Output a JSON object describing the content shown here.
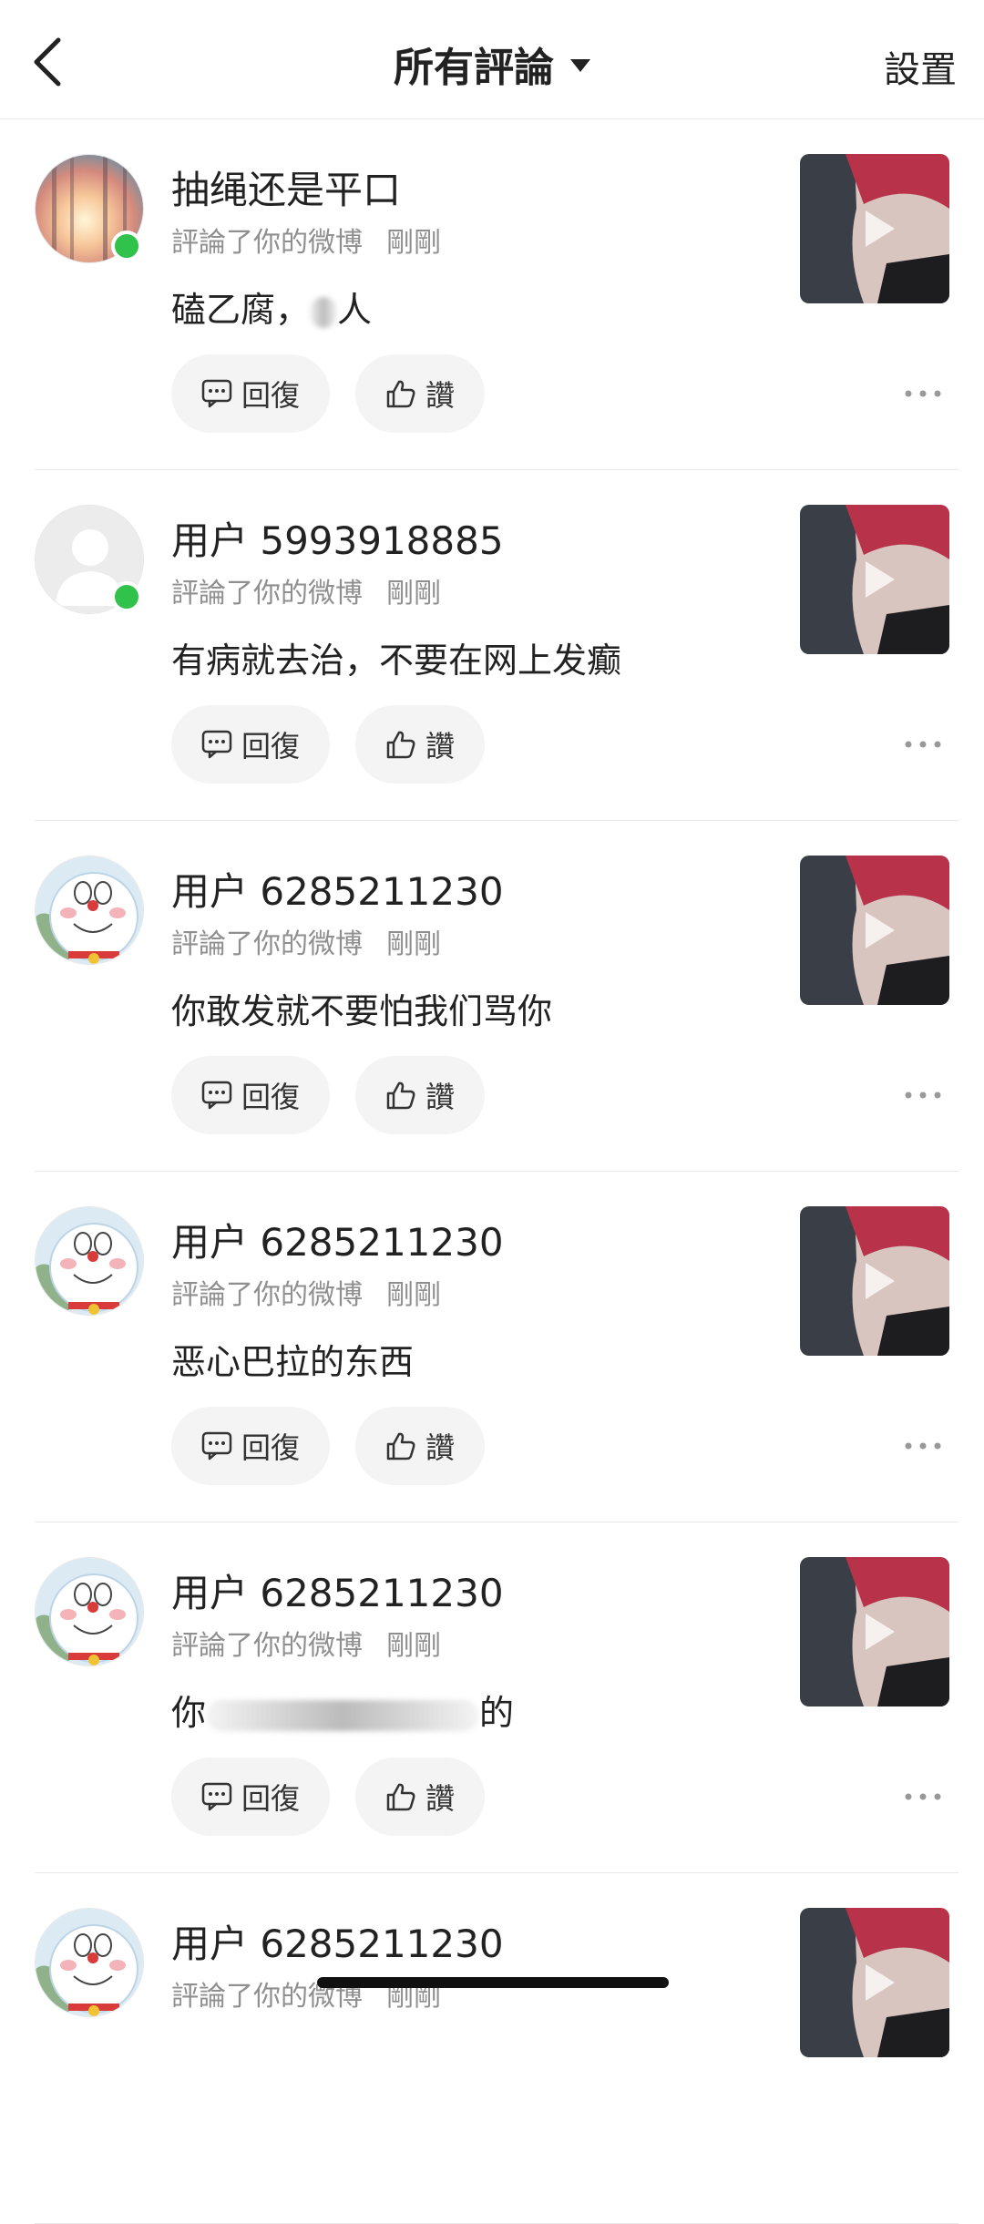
{
  "header": {
    "title": "所有評論",
    "settings_label": "設置"
  },
  "comments": [
    {
      "username": "抽绳还是平口",
      "action": "評論了你的微博",
      "time": "剛剛",
      "text_before": "磕乙腐，",
      "text_after": "人",
      "online": true,
      "avatar": "forest-sunset-avatar"
    },
    {
      "username": "用户 5993918885",
      "action": "評論了你的微博",
      "time": "剛剛",
      "text_before": "有病就去治，不要在网上发癫",
      "text_after": "",
      "online": true,
      "avatar": "default-avatar"
    },
    {
      "username": "用户 6285211230",
      "action": "評論了你的微博",
      "time": "剛剛",
      "text_before": "你敢发就不要怕我们骂你",
      "text_after": "",
      "online": false,
      "avatar": "doraemon-avatar"
    },
    {
      "username": "用户 6285211230",
      "action": "評論了你的微博",
      "time": "剛剛",
      "text_before": "恶心巴拉的东西",
      "text_after": "",
      "online": false,
      "avatar": "doraemon-avatar"
    },
    {
      "username": "用户 6285211230",
      "action": "評論了你的微博",
      "time": "剛剛",
      "text_before": "你",
      "text_after": "的",
      "online": false,
      "avatar": "doraemon-avatar"
    },
    {
      "username": "用户 6285211230",
      "action": "評論了你的微博",
      "time": "剛剛",
      "text_before": "",
      "text_after": "",
      "online": false,
      "avatar": "doraemon-avatar"
    }
  ],
  "actions": {
    "reply_label": "回復",
    "like_label": "讚"
  },
  "colors": {
    "online_dot": "#31c24b",
    "meta_text": "#8f8f8f",
    "button_bg": "#f4f4f4"
  }
}
